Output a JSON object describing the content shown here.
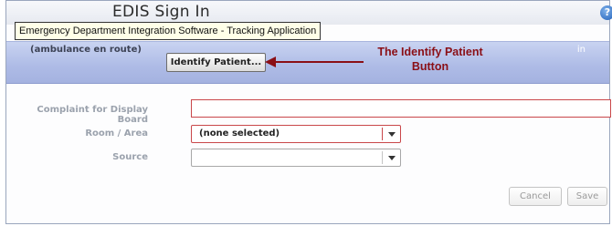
{
  "window": {
    "title": "EDIS Sign In",
    "help_glyph": "?"
  },
  "tooltip": "Emergency Department Integration Software - Tracking Application",
  "patient_band": {
    "status": "(ambulance en route)",
    "in_label": "in",
    "identify_button": "Identify Patient..."
  },
  "annotation": {
    "line1": "The Identify Patient",
    "line2": "Button",
    "color": "#8a0f16"
  },
  "form": {
    "complaint_label": "Complaint for Display Board",
    "complaint_value": "",
    "room_label": "Room / Area",
    "room_value": "(none selected)",
    "source_label": "Source",
    "source_value": ""
  },
  "buttons": {
    "cancel": "Cancel",
    "save": "Save"
  },
  "colors": {
    "band": "#aebbe6",
    "error_border": "#c9474a",
    "label": "#9ba2ad"
  }
}
